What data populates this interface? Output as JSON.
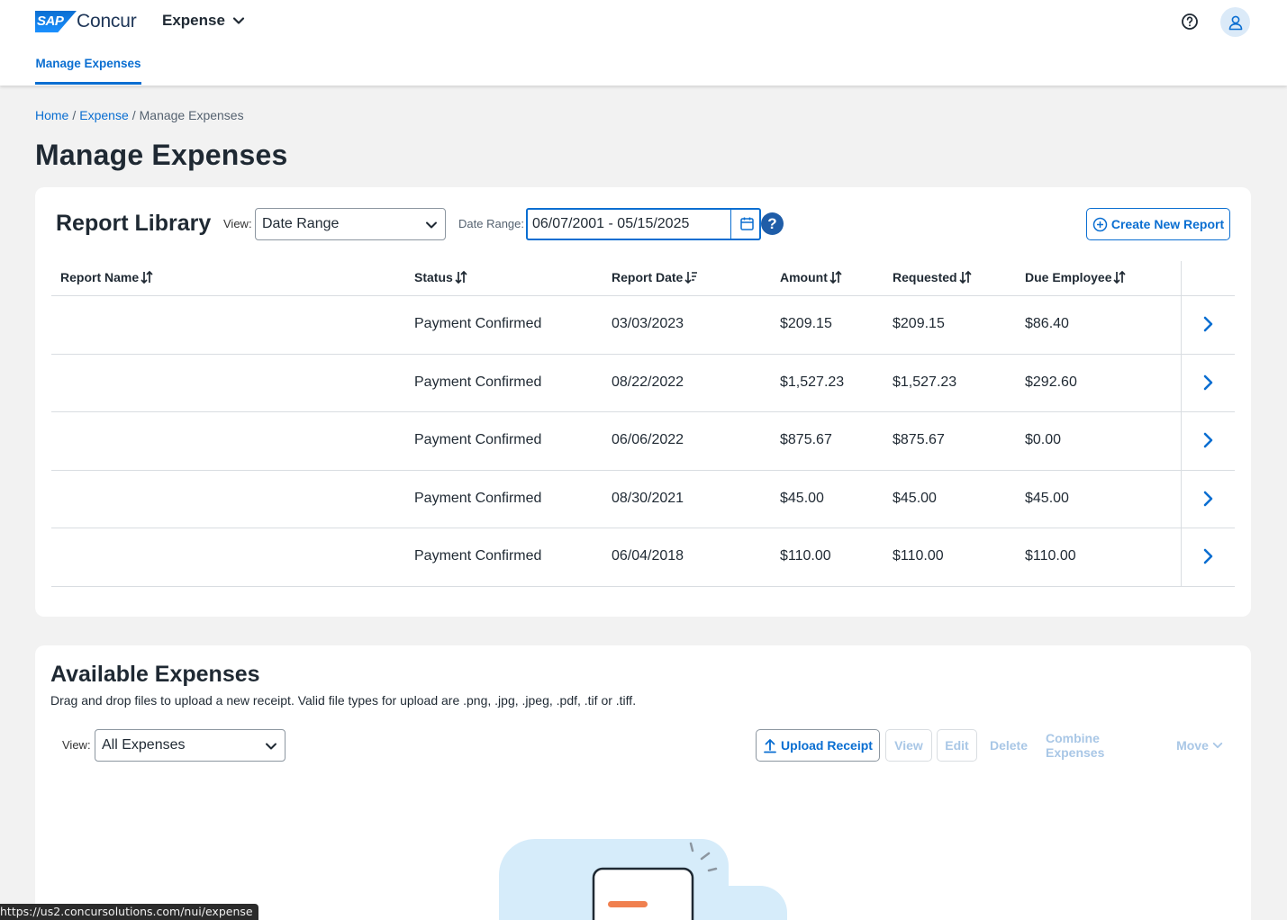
{
  "topbar": {
    "logo_sap": "SAP",
    "logo_product": "Concur",
    "app_name": "Expense",
    "tab_label": "Manage Expenses"
  },
  "breadcrumb": {
    "home": "Home",
    "expense": "Expense",
    "current": "Manage Expenses",
    "separator": "/"
  },
  "page_title": "Manage Expenses",
  "report_library": {
    "title": "Report Library",
    "view_label": "View:",
    "view_value": "Date Range",
    "date_range_label": "Date Range:",
    "date_range_value": "06/07/2001 - 05/15/2025",
    "help_glyph": "?",
    "create_button": "Create New Report",
    "columns": [
      "Report Name",
      "Status",
      "Report Date",
      "Amount",
      "Requested",
      "Due Employee"
    ],
    "rows": [
      {
        "name": "",
        "status": "Payment Confirmed",
        "date": "03/03/2023",
        "amount": "$209.15",
        "requested": "$209.15",
        "due": "$86.40"
      },
      {
        "name": "",
        "status": "Payment Confirmed",
        "date": "08/22/2022",
        "amount": "$1,527.23",
        "requested": "$1,527.23",
        "due": "$292.60"
      },
      {
        "name": "",
        "status": "Payment Confirmed",
        "date": "06/06/2022",
        "amount": "$875.67",
        "requested": "$875.67",
        "due": "$0.00"
      },
      {
        "name": "",
        "status": "Payment Confirmed",
        "date": "08/30/2021",
        "amount": "$45.00",
        "requested": "$45.00",
        "due": "$45.00"
      },
      {
        "name": "",
        "status": "Payment Confirmed",
        "date": "06/04/2018",
        "amount": "$110.00",
        "requested": "$110.00",
        "due": "$110.00"
      }
    ]
  },
  "available_expenses": {
    "title": "Available Expenses",
    "description": "Drag and drop files to upload a new receipt. Valid file types for upload are .png, .jpg, .jpeg, .pdf, .tif or .tiff.",
    "view_label": "View:",
    "view_value": "All Expenses",
    "buttons": {
      "upload": "Upload Receipt",
      "view": "View",
      "edit": "Edit",
      "delete": "Delete",
      "combine": "Combine Expenses",
      "move": "Move"
    }
  },
  "status_bar_url": "https://us2.concursolutions.com/nui/expense",
  "colors": {
    "accent": "#0a6ed1",
    "help_dark": "#1f5da8",
    "disabled": "#a9c7e6",
    "background": "#f2f2f2"
  },
  "icons": [
    "chevron-down-icon",
    "help-circle-icon",
    "user-icon",
    "calendar-icon",
    "plus-circle-icon",
    "sort-icon",
    "chevron-right-icon",
    "upload-icon"
  ]
}
